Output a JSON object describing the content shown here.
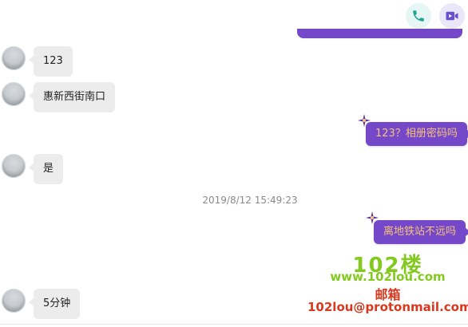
{
  "header": {
    "voice_call_icon": "phone-icon",
    "video_call_icon": "video-icon",
    "accent_teal": "#1fa692",
    "accent_purple": "#6c4fd1"
  },
  "messages": [
    {
      "side": "in",
      "text": "123"
    },
    {
      "side": "in",
      "text": "惠新西街南口"
    },
    {
      "side": "out",
      "text": "123？相册密码吗"
    },
    {
      "side": "in",
      "text": "是"
    },
    {
      "side": "out",
      "text": "离地铁站不远吗"
    },
    {
      "side": "in",
      "text": "5分钟"
    }
  ],
  "timestamp": "2019/8/12 15:49:23",
  "watermark": {
    "logo": "102楼",
    "url": "www.102lou.com",
    "mail_label": "邮箱",
    "email": "102lou@protonmail.com"
  },
  "colors": {
    "incoming_bubble": "#ececec",
    "outgoing_bubble": "#7547c9",
    "outgoing_text": "#f6c37a"
  }
}
